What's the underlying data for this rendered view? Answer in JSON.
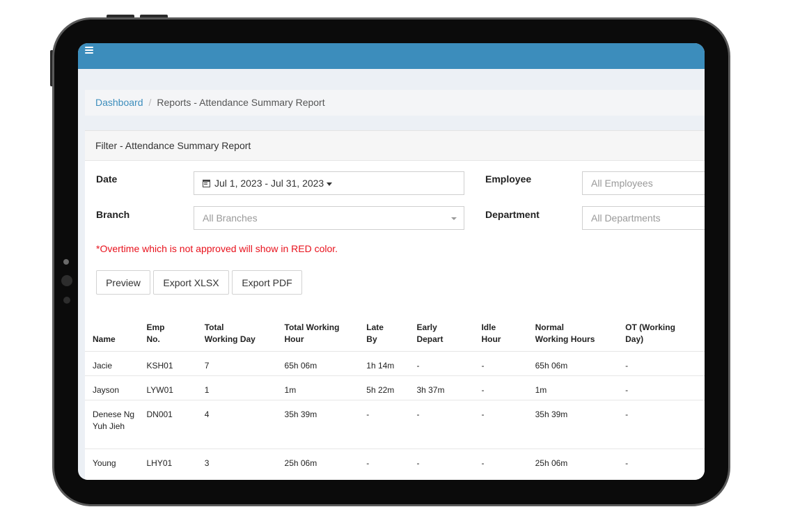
{
  "breadcrumb": {
    "home": "Dashboard",
    "separator": "/",
    "current": "Reports - Attendance Summary Report"
  },
  "filter": {
    "title": "Filter - Attendance Summary Report",
    "date_label": "Date",
    "date_value": "Jul 1, 2023 - Jul 31, 2023",
    "employee_label": "Employee",
    "employee_placeholder": "All Employees",
    "branch_label": "Branch",
    "branch_placeholder": "All Branches",
    "department_label": "Department",
    "department_placeholder": "All Departments",
    "note": "*Overtime which is not approved will show in RED color.",
    "note_color": "#e8111c"
  },
  "buttons": {
    "preview": "Preview",
    "export_xlsx": "Export XLSX",
    "export_pdf": "Export PDF"
  },
  "table": {
    "headers": [
      [
        "Name"
      ],
      [
        "Emp",
        "No."
      ],
      [
        "Total",
        "Working Day"
      ],
      [
        "Total Working",
        "Hour"
      ],
      [
        "Late",
        "By"
      ],
      [
        "Early",
        "Depart"
      ],
      [
        "Idle",
        "Hour"
      ],
      [
        "Normal",
        "Working Hours"
      ],
      [
        "OT (Working",
        "Day)"
      ],
      [
        ""
      ]
    ],
    "rows": [
      [
        "Jacie",
        "KSH01",
        "7",
        "65h 06m",
        "1h 14m",
        "-",
        "-",
        "65h 06m",
        "-",
        "-"
      ],
      [
        "Jayson",
        "LYW01",
        "1",
        "1m",
        "5h 22m",
        "3h 37m",
        "-",
        "1m",
        "-",
        "-"
      ],
      [
        "Denese Ng Yuh Jieh",
        "DN001",
        "4",
        "35h 39m",
        "-",
        "-",
        "-",
        "35h 39m",
        "-",
        "-"
      ],
      [
        "Young",
        "LHY01",
        "3",
        "25h 06m",
        "-",
        "-",
        "-",
        "25h 06m",
        "-",
        "-"
      ]
    ]
  },
  "colors": {
    "topbar": "#3c8dbc",
    "link": "#3c8dbc"
  },
  "icons": {
    "menu": "hamburger-menu-icon",
    "date": "calendar-icon"
  }
}
